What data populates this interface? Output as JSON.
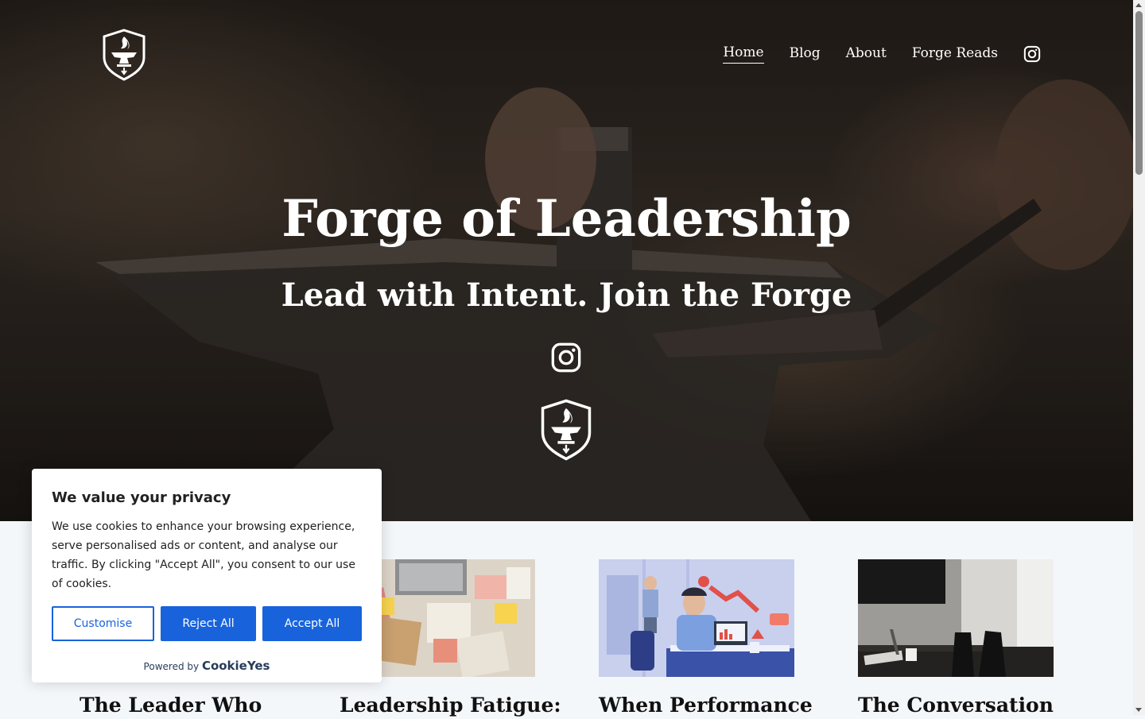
{
  "nav": {
    "items": [
      {
        "label": "Home",
        "active": true
      },
      {
        "label": "Blog",
        "active": false
      },
      {
        "label": "About",
        "active": false
      },
      {
        "label": "Forge Reads",
        "active": false
      }
    ],
    "instagram_icon": "instagram-icon",
    "logo_icon": "anvil-flame-shield-icon"
  },
  "hero": {
    "title": "Forge of Leadership",
    "subtitle": "Lead with Intent. Join the Forge",
    "instagram_icon": "instagram-icon",
    "logo_icon": "anvil-flame-shield-icon"
  },
  "posts": [
    {
      "title": "The Leader Who",
      "thumb": "leader-photo"
    },
    {
      "title": "Leadership Fatigue:",
      "thumb": "messy-desk-photo"
    },
    {
      "title": "When Performance",
      "thumb": "stressed-worker-illustration"
    },
    {
      "title": "The Conversation",
      "thumb": "meeting-room-photo"
    }
  ],
  "cookie": {
    "title": "We value your privacy",
    "body": "We use cookies to enhance your browsing experience, serve personalised ads or content, and analyse our traffic. By clicking \"Accept All\", you consent to our use of cookies.",
    "customise": "Customise",
    "reject": "Reject All",
    "accept": "Accept All",
    "powered_by": "Powered by",
    "brand": "CookieYes"
  },
  "colors": {
    "accent": "#1863dc",
    "hero_text": "#ffffff",
    "page_bg": "#f4f7fa"
  }
}
